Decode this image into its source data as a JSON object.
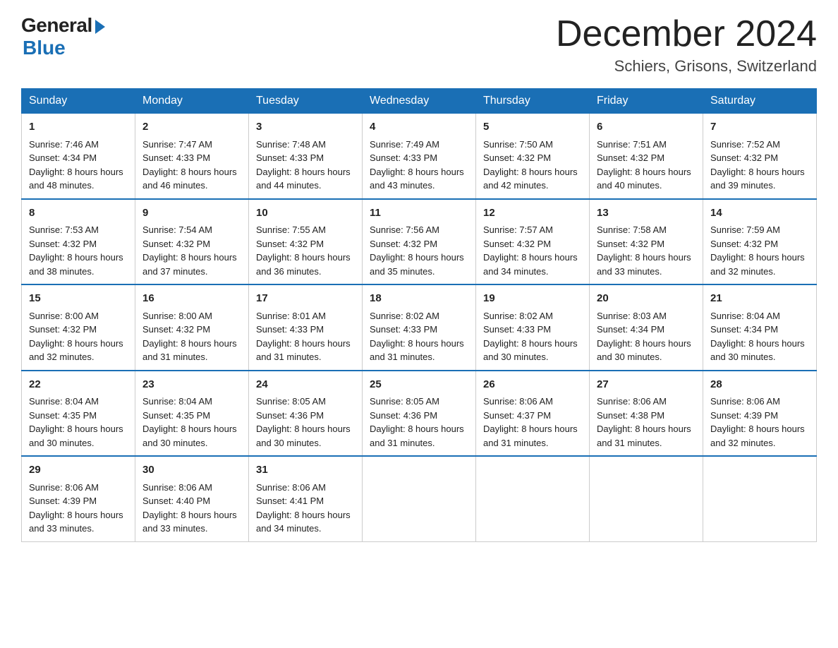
{
  "header": {
    "logo_general": "General",
    "logo_blue": "Blue",
    "month_title": "December 2024",
    "location": "Schiers, Grisons, Switzerland"
  },
  "days_of_week": [
    "Sunday",
    "Monday",
    "Tuesday",
    "Wednesday",
    "Thursday",
    "Friday",
    "Saturday"
  ],
  "weeks": [
    [
      {
        "day": "1",
        "sunrise": "7:46 AM",
        "sunset": "4:34 PM",
        "daylight": "8 hours and 48 minutes."
      },
      {
        "day": "2",
        "sunrise": "7:47 AM",
        "sunset": "4:33 PM",
        "daylight": "8 hours and 46 minutes."
      },
      {
        "day": "3",
        "sunrise": "7:48 AM",
        "sunset": "4:33 PM",
        "daylight": "8 hours and 44 minutes."
      },
      {
        "day": "4",
        "sunrise": "7:49 AM",
        "sunset": "4:33 PM",
        "daylight": "8 hours and 43 minutes."
      },
      {
        "day": "5",
        "sunrise": "7:50 AM",
        "sunset": "4:32 PM",
        "daylight": "8 hours and 42 minutes."
      },
      {
        "day": "6",
        "sunrise": "7:51 AM",
        "sunset": "4:32 PM",
        "daylight": "8 hours and 40 minutes."
      },
      {
        "day": "7",
        "sunrise": "7:52 AM",
        "sunset": "4:32 PM",
        "daylight": "8 hours and 39 minutes."
      }
    ],
    [
      {
        "day": "8",
        "sunrise": "7:53 AM",
        "sunset": "4:32 PM",
        "daylight": "8 hours and 38 minutes."
      },
      {
        "day": "9",
        "sunrise": "7:54 AM",
        "sunset": "4:32 PM",
        "daylight": "8 hours and 37 minutes."
      },
      {
        "day": "10",
        "sunrise": "7:55 AM",
        "sunset": "4:32 PM",
        "daylight": "8 hours and 36 minutes."
      },
      {
        "day": "11",
        "sunrise": "7:56 AM",
        "sunset": "4:32 PM",
        "daylight": "8 hours and 35 minutes."
      },
      {
        "day": "12",
        "sunrise": "7:57 AM",
        "sunset": "4:32 PM",
        "daylight": "8 hours and 34 minutes."
      },
      {
        "day": "13",
        "sunrise": "7:58 AM",
        "sunset": "4:32 PM",
        "daylight": "8 hours and 33 minutes."
      },
      {
        "day": "14",
        "sunrise": "7:59 AM",
        "sunset": "4:32 PM",
        "daylight": "8 hours and 32 minutes."
      }
    ],
    [
      {
        "day": "15",
        "sunrise": "8:00 AM",
        "sunset": "4:32 PM",
        "daylight": "8 hours and 32 minutes."
      },
      {
        "day": "16",
        "sunrise": "8:00 AM",
        "sunset": "4:32 PM",
        "daylight": "8 hours and 31 minutes."
      },
      {
        "day": "17",
        "sunrise": "8:01 AM",
        "sunset": "4:33 PM",
        "daylight": "8 hours and 31 minutes."
      },
      {
        "day": "18",
        "sunrise": "8:02 AM",
        "sunset": "4:33 PM",
        "daylight": "8 hours and 31 minutes."
      },
      {
        "day": "19",
        "sunrise": "8:02 AM",
        "sunset": "4:33 PM",
        "daylight": "8 hours and 30 minutes."
      },
      {
        "day": "20",
        "sunrise": "8:03 AM",
        "sunset": "4:34 PM",
        "daylight": "8 hours and 30 minutes."
      },
      {
        "day": "21",
        "sunrise": "8:04 AM",
        "sunset": "4:34 PM",
        "daylight": "8 hours and 30 minutes."
      }
    ],
    [
      {
        "day": "22",
        "sunrise": "8:04 AM",
        "sunset": "4:35 PM",
        "daylight": "8 hours and 30 minutes."
      },
      {
        "day": "23",
        "sunrise": "8:04 AM",
        "sunset": "4:35 PM",
        "daylight": "8 hours and 30 minutes."
      },
      {
        "day": "24",
        "sunrise": "8:05 AM",
        "sunset": "4:36 PM",
        "daylight": "8 hours and 30 minutes."
      },
      {
        "day": "25",
        "sunrise": "8:05 AM",
        "sunset": "4:36 PM",
        "daylight": "8 hours and 31 minutes."
      },
      {
        "day": "26",
        "sunrise": "8:06 AM",
        "sunset": "4:37 PM",
        "daylight": "8 hours and 31 minutes."
      },
      {
        "day": "27",
        "sunrise": "8:06 AM",
        "sunset": "4:38 PM",
        "daylight": "8 hours and 31 minutes."
      },
      {
        "day": "28",
        "sunrise": "8:06 AM",
        "sunset": "4:39 PM",
        "daylight": "8 hours and 32 minutes."
      }
    ],
    [
      {
        "day": "29",
        "sunrise": "8:06 AM",
        "sunset": "4:39 PM",
        "daylight": "8 hours and 33 minutes."
      },
      {
        "day": "30",
        "sunrise": "8:06 AM",
        "sunset": "4:40 PM",
        "daylight": "8 hours and 33 minutes."
      },
      {
        "day": "31",
        "sunrise": "8:06 AM",
        "sunset": "4:41 PM",
        "daylight": "8 hours and 34 minutes."
      },
      null,
      null,
      null,
      null
    ]
  ],
  "labels": {
    "sunrise": "Sunrise: ",
    "sunset": "Sunset: ",
    "daylight": "Daylight: "
  }
}
